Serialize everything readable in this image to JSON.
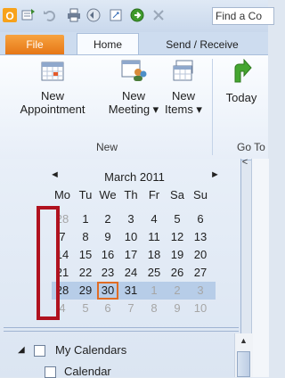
{
  "toolbar": {
    "find_placeholder": "Find a Co"
  },
  "tabs": {
    "file": "File",
    "home": "Home",
    "send_receive": "Send / Receive"
  },
  "ribbon": {
    "new_appointment": [
      "New",
      "Appointment"
    ],
    "new_meeting": [
      "New",
      "Meeting ▾"
    ],
    "new_items": [
      "New",
      "Items ▾"
    ],
    "today": "Today",
    "group_new": "New",
    "group_goto": "Go To"
  },
  "calendar": {
    "month": "March 2011",
    "prev": "◄",
    "next": "►",
    "weekdays": [
      "Mo",
      "Tu",
      "We",
      "Th",
      "Fr",
      "Sa",
      "Su"
    ],
    "weeks": [
      [
        "28",
        "1",
        "2",
        "3",
        "4",
        "5",
        "6"
      ],
      [
        "7",
        "8",
        "9",
        "10",
        "11",
        "12",
        "13"
      ],
      [
        "14",
        "15",
        "16",
        "17",
        "18",
        "19",
        "20"
      ],
      [
        "21",
        "22",
        "23",
        "24",
        "25",
        "26",
        "27"
      ],
      [
        "28",
        "29",
        "30",
        "31",
        "1",
        "2",
        "3"
      ],
      [
        "4",
        "5",
        "6",
        "7",
        "8",
        "9",
        "10"
      ]
    ],
    "today": "30"
  },
  "nav": {
    "collapse": "<",
    "my_calendars": "My Calendars",
    "calendar": "Calendar"
  },
  "colors": {
    "file_tab": "#e57515",
    "highlight": "#b7cde8",
    "today_border": "#e06c24",
    "annotation_red": "#b0121f"
  }
}
